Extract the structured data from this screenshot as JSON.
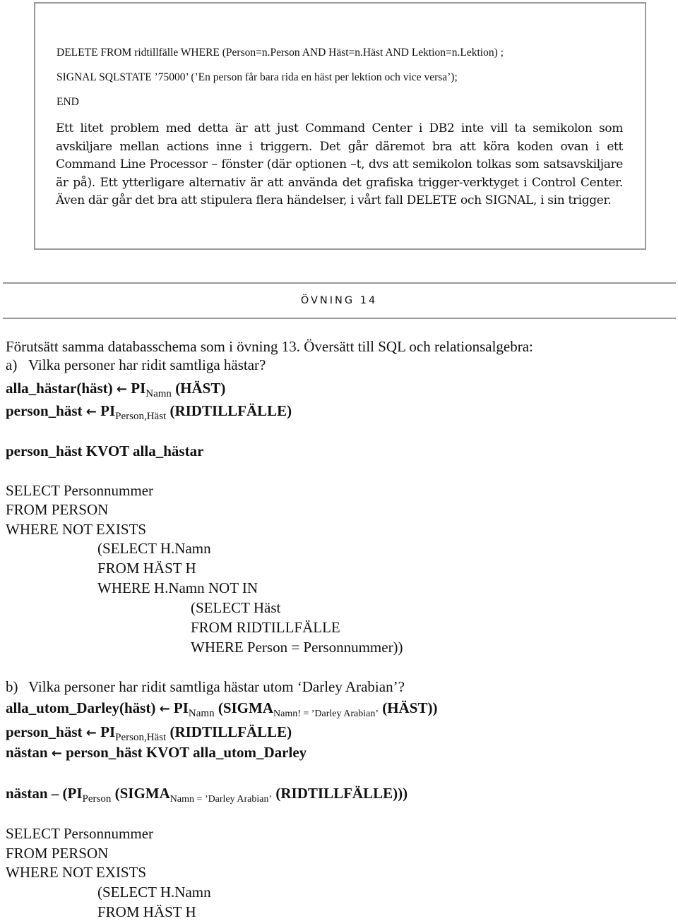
{
  "box": {
    "code_lines": [
      "DELETE FROM ridtillfälle WHERE (Person=n.Person AND Häst=n.Häst AND Lektion=n.Lektion) ;",
      "SIGNAL SQLSTATE ’75000’ (’En person får bara rida en häst per lektion och vice versa’);",
      "END"
    ],
    "paragraph": "Ett litet problem med detta är att just Command Center i DB2 inte vill ta semikolon som avskiljare mellan actions inne i triggern. Det går däremot bra att köra koden ovan i ett Command Line Processor – fönster (där optionen –t, dvs att semikolon tolkas som satsavskiljare är på). Ett ytterligare alternativ är att använda det grafiska trigger-verktyget i Control Center. Även där går det bra att stipulera flera händelser, i vårt fall DELETE och SIGNAL, i sin trigger."
  },
  "section": {
    "heading": "ÖVNING 14",
    "intro": "Förutsätt samma databasschema som i övning 13. Översätt till SQL och relationsalgebra:",
    "arrow_glyph": "←",
    "part_a": {
      "label": "a)",
      "question": "Vilka personer har ridit samtliga hästar?",
      "algebra": [
        {
          "lhs": "alla_hästar(häst)",
          "op": "PI",
          "sub": "Namn",
          "rest": "(HÄST)"
        },
        {
          "lhs": "person_häst",
          "op": "PI",
          "sub": "Person,Häst",
          "rest": "(RIDTILLFÄLLE)"
        }
      ],
      "division": "person_häst KVOT alla_hästar",
      "sql": [
        "SELECT Personnummer",
        "FROM PERSON",
        "WHERE NOT EXISTS",
        "(SELECT H.Namn",
        "FROM HÄST H",
        "WHERE H.Namn NOT IN",
        "(SELECT Häst",
        "FROM RIDTILLFÄLLE",
        "WHERE Person = Personnummer))"
      ]
    },
    "part_b": {
      "label": "b)",
      "question": "Vilka personer har ridit samtliga hästar utom ‘Darley Arabian’?",
      "algebra1": {
        "lhs": "alla_utom_Darley(häst)",
        "op": "PI",
        "sub": "Namn",
        "sigma": "(SIGMA",
        "sigma_sub": "Namn! = ’Darley Arabian’",
        "rest": "(HÄST))"
      },
      "algebra2": {
        "lhs": "person_häst",
        "op": "PI",
        "sub": "Person,Häst",
        "rest": "(RIDTILLFÄLLE)"
      },
      "algebra3": {
        "lhs": "nästan",
        "rest": "person_häst KVOT alla_utom_Darley"
      },
      "difference": {
        "lhs": "nästan – (PI",
        "sub": "Person",
        "sigma": "(SIGMA",
        "sigma_sub": "Namn = ’Darley Arabian’",
        "rest": "(RIDTILLFÄLLE)))"
      },
      "sql": [
        "SELECT Personnummer",
        "FROM PERSON",
        "WHERE NOT EXISTS",
        "(SELECT H.Namn",
        "FROM HÄST H"
      ]
    }
  }
}
